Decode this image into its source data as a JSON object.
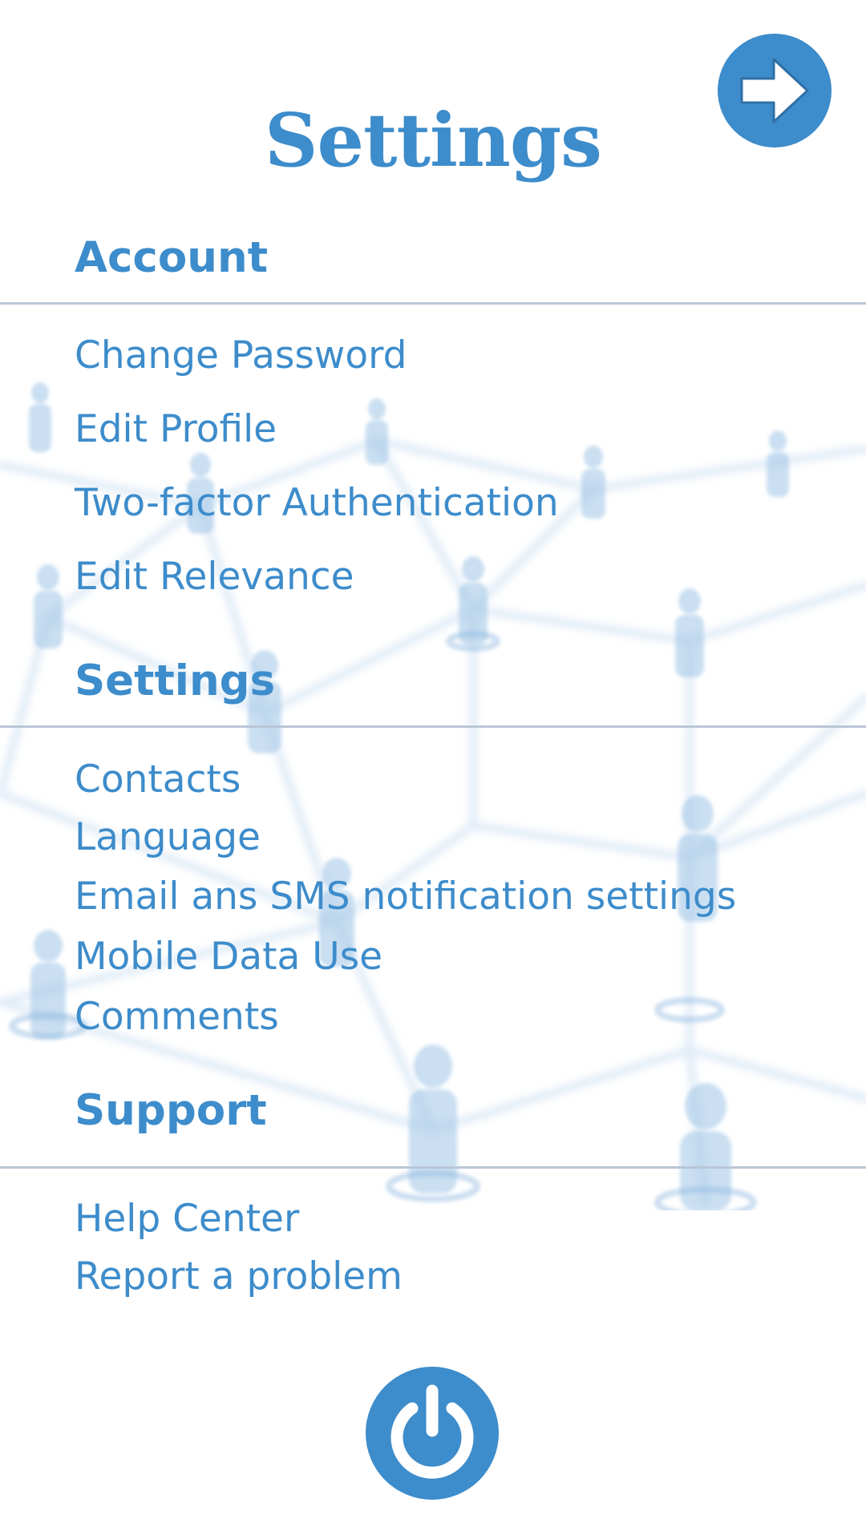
{
  "page": {
    "title": "Settings"
  },
  "header": {
    "next_icon": "arrow-right-icon"
  },
  "sections": {
    "account": {
      "heading": "Account",
      "items": [
        "Change Password",
        "Edit Profile",
        "Two-factor Authentication",
        "Edit Relevance"
      ]
    },
    "settings": {
      "heading": "Settings",
      "items": [
        "Contacts",
        "Language",
        "Email ans SMS notification settings",
        "Mobile Data Use",
        "Comments"
      ]
    },
    "support": {
      "heading": "Support",
      "items": [
        "Help Center",
        "Report a problem"
      ]
    }
  },
  "footer": {
    "power_icon": "power-icon"
  },
  "colors": {
    "accent": "#3d8ccb",
    "divider": "#b9c6d6",
    "background": "#ffffff",
    "network_lines": "#c7dcf0",
    "network_people": "#9fc5e6"
  }
}
